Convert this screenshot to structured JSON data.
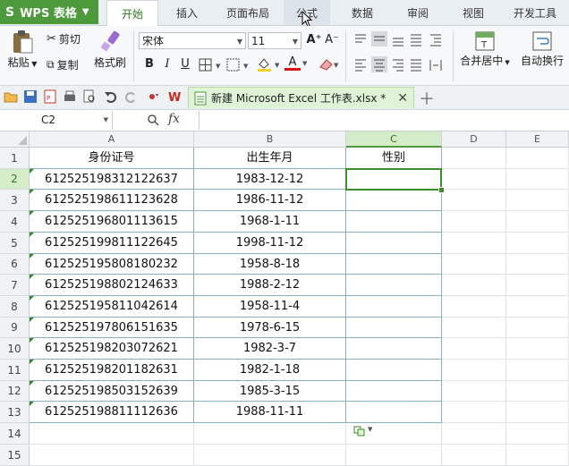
{
  "app": {
    "logo": "S",
    "name": "WPS 表格"
  },
  "menu_tabs": [
    "开始",
    "插入",
    "页面布局",
    "公式",
    "数据",
    "审阅",
    "视图",
    "开发工具"
  ],
  "ribbon": {
    "paste": "粘贴",
    "cut": "剪切",
    "copy": "复制",
    "format_painter": "格式刷",
    "font_name": "宋体",
    "font_size": "11",
    "bold": "B",
    "italic": "I",
    "underline": "U",
    "font_color_letter": "A",
    "grow_font": "A⁺",
    "shrink_font": "A⁻",
    "merge_center": "合并居中",
    "wrap_text": "自动换行"
  },
  "doc_tab": {
    "title": "新建 Microsoft Excel 工作表.xlsx *"
  },
  "formula_bar": {
    "cell_ref": "C2",
    "fx_label": "fx",
    "value": ""
  },
  "sheet": {
    "columns": [
      "A",
      "B",
      "C",
      "D",
      "E"
    ],
    "rows": [
      "1",
      "2",
      "3",
      "4",
      "5",
      "6",
      "7",
      "8",
      "9",
      "10",
      "11",
      "12",
      "13",
      "14",
      "15"
    ],
    "header": [
      "身份证号",
      "出生年月",
      "性别"
    ],
    "data": [
      [
        "612525198312122637",
        "1983-12-12",
        ""
      ],
      [
        "612525198611123628",
        "1986-11-12",
        ""
      ],
      [
        "612525196801113615",
        "1968-1-11",
        ""
      ],
      [
        "612525199811122645",
        "1998-11-12",
        ""
      ],
      [
        "612525195808180232",
        "1958-8-18",
        ""
      ],
      [
        "612525198802124633",
        "1988-2-12",
        ""
      ],
      [
        "612525195811042614",
        "1958-11-4",
        ""
      ],
      [
        "612525197806151635",
        "1978-6-15",
        ""
      ],
      [
        "612525198203072621",
        "1982-3-7",
        ""
      ],
      [
        "612525198201182631",
        "1982-1-18",
        ""
      ],
      [
        "612525198503152639",
        "1985-3-15",
        ""
      ],
      [
        "612525198811112636",
        "1988-11-11",
        ""
      ]
    ]
  },
  "colors": {
    "accent": "#4d9a3d",
    "selection": "#3a8f2b"
  }
}
